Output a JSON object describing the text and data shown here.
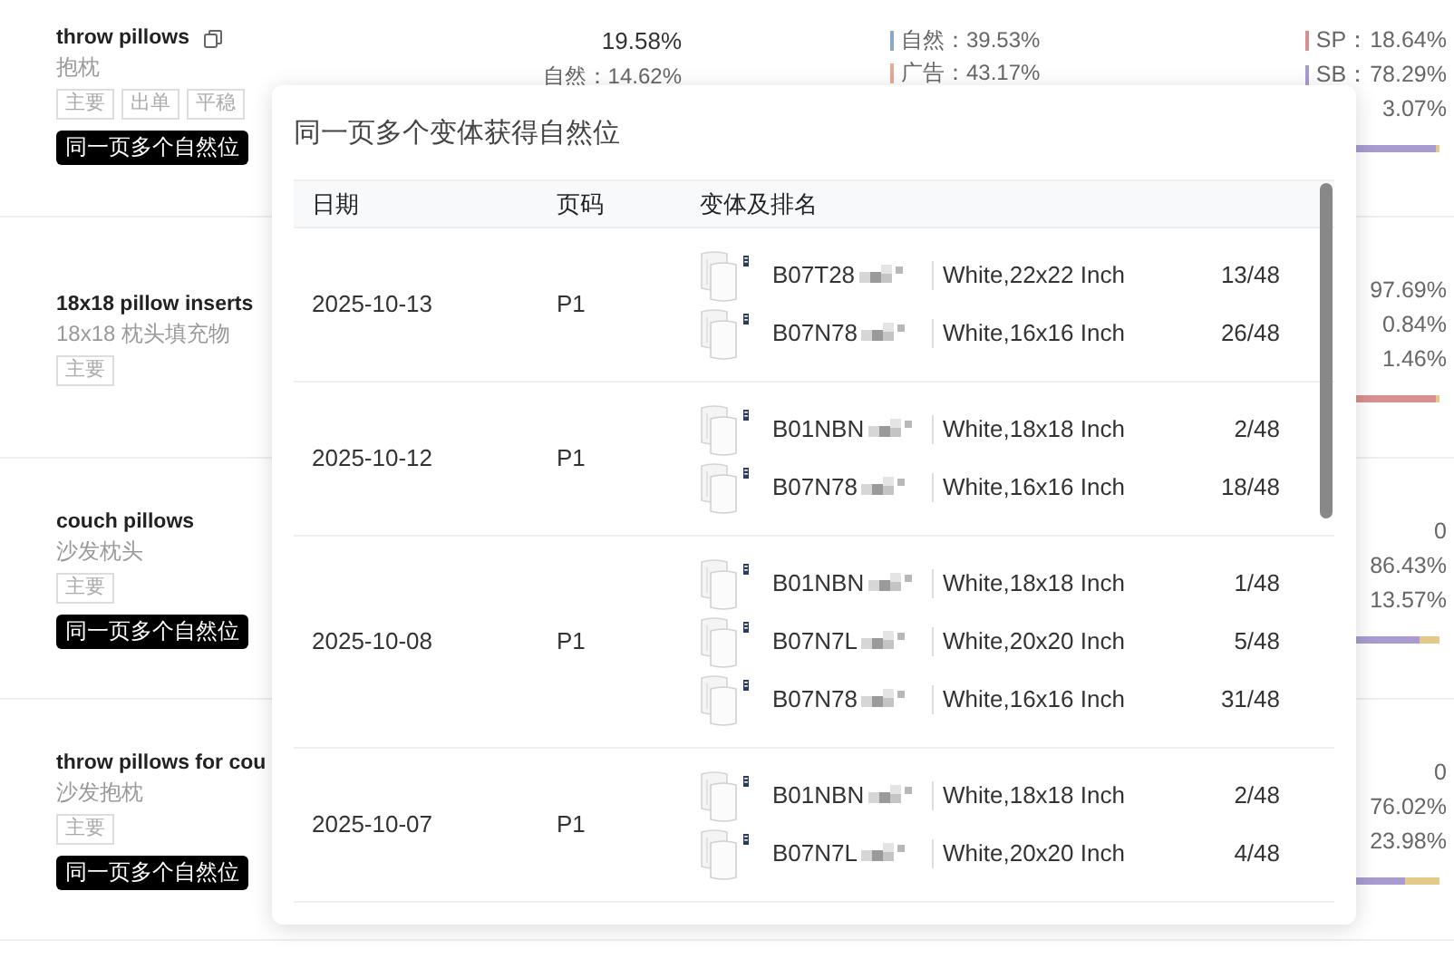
{
  "rows": [
    {
      "keyword": "throw pillows",
      "translation": "抱枕",
      "copyable": true,
      "tags": [
        "主要",
        "出单",
        "平稳"
      ],
      "badge": "同一页多个自然位",
      "total": "19.58%",
      "total_split": "自然：14.62%",
      "traffic": [
        {
          "text": "自然：39.53%",
          "color": "#8ea7c9"
        },
        {
          "text": "广告：43.17%",
          "color": "#e2ab98"
        }
      ],
      "ads": [
        {
          "text": "SP：18.64%",
          "color": "#d98f8f"
        },
        {
          "text": "SB：78.29%",
          "color": "#a99bd0"
        },
        {
          "text": "3.07%"
        }
      ],
      "bar": [
        {
          "color": "#a99bd0",
          "level": 0.97
        },
        {
          "color": "#e3c98a",
          "level": 0.03
        }
      ]
    },
    {
      "keyword": "18x18 pillow inserts",
      "translation": "18x18 枕头填充物",
      "copyable": false,
      "tags": [
        "主要"
      ],
      "ads": [
        {
          "text": "97.69%"
        },
        {
          "text": "0.84%"
        },
        {
          "text": "1.46%"
        }
      ],
      "bar": [
        {
          "color": "#d98f8f",
          "level": 0.98
        },
        {
          "color": "#e3c98a",
          "level": 0.02
        }
      ]
    },
    {
      "keyword": "couch pillows",
      "translation": "沙发枕头",
      "copyable": false,
      "tags": [
        "主要"
      ],
      "badge": "同一页多个自然位",
      "ads": [
        {
          "text": "0"
        },
        {
          "text": "86.43%"
        },
        {
          "text": "13.57%"
        }
      ],
      "bar": [
        {
          "color": "#a99bd0",
          "level": 0.86
        },
        {
          "color": "#e3c98a",
          "level": 0.14
        }
      ]
    },
    {
      "keyword": "throw pillows for cou",
      "translation": "沙发抱枕",
      "copyable": false,
      "tags": [
        "主要"
      ],
      "badge": "同一页多个自然位",
      "ads": [
        {
          "text": "0"
        },
        {
          "text": "76.02%"
        },
        {
          "text": "23.98%"
        }
      ],
      "bar": [
        {
          "color": "#a99bd0",
          "level": 0.76
        },
        {
          "color": "#e3c98a",
          "level": 0.24
        }
      ]
    }
  ],
  "popup": {
    "title": "同一页多个变体获得自然位",
    "columns": [
      "日期",
      "页码",
      "变体及排名"
    ],
    "rows": [
      {
        "date": "2025-10-13",
        "page": "P1",
        "variants": [
          {
            "asin": "B07T28",
            "variant": "White,22x22 Inch",
            "rank": "13/48"
          },
          {
            "asin": "B07N78",
            "variant": "White,16x16 Inch",
            "rank": "26/48"
          }
        ]
      },
      {
        "date": "2025-10-12",
        "page": "P1",
        "variants": [
          {
            "asin": "B01NBN",
            "variant": "White,18x18 Inch",
            "rank": "2/48"
          },
          {
            "asin": "B07N78",
            "variant": "White,16x16 Inch",
            "rank": "18/48"
          }
        ]
      },
      {
        "date": "2025-10-08",
        "page": "P1",
        "variants": [
          {
            "asin": "B01NBN",
            "variant": "White,18x18 Inch",
            "rank": "1/48"
          },
          {
            "asin": "B07N7L",
            "variant": "White,20x20 Inch",
            "rank": "5/48"
          },
          {
            "asin": "B07N78",
            "variant": "White,16x16 Inch",
            "rank": "31/48"
          }
        ]
      },
      {
        "date": "2025-10-07",
        "page": "P1",
        "variants": [
          {
            "asin": "B01NBN",
            "variant": "White,18x18 Inch",
            "rank": "2/48"
          },
          {
            "asin": "B07N7L",
            "variant": "White,20x20 Inch",
            "rank": "4/48"
          }
        ]
      }
    ]
  }
}
